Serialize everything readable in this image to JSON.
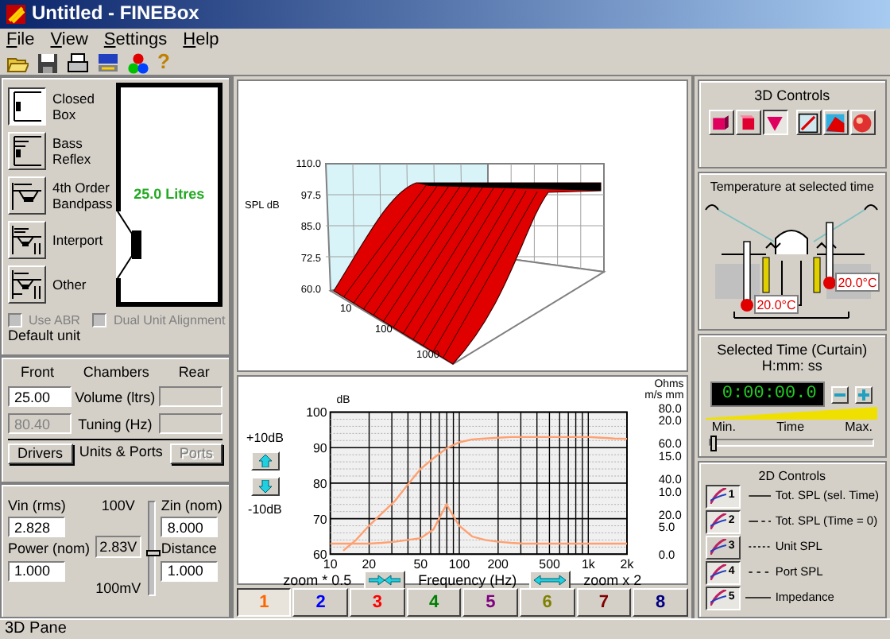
{
  "window": {
    "title": "Untitled - FINEBox"
  },
  "menu": [
    {
      "label": "File"
    },
    {
      "label": "View"
    },
    {
      "label": "Settings"
    },
    {
      "label": "Help"
    }
  ],
  "toolbar": [
    {
      "kind": "open"
    },
    {
      "kind": "save"
    },
    {
      "kind": "print"
    },
    {
      "kind": "panel"
    },
    {
      "kind": "colors"
    },
    {
      "kind": "help",
      "glyph": "?"
    }
  ],
  "enclosures": [
    {
      "kind": "closed",
      "label": "Closed Box",
      "selected": true
    },
    {
      "kind": "bass",
      "label": "Bass Reflex",
      "selected": false
    },
    {
      "kind": "bandpass",
      "label": "4th Order Bandpass",
      "selected": false
    },
    {
      "kind": "interport",
      "label": "Interport",
      "selected": false
    },
    {
      "kind": "other",
      "label": "Other",
      "selected": false
    }
  ],
  "box_display": {
    "volume": "25.0 Litres"
  },
  "options": [
    {
      "label": "Use ABR",
      "checked": false,
      "disabled": true
    },
    {
      "label": "Dual Unit Alignment",
      "checked": false,
      "disabled": true
    }
  ],
  "default_unit": "Default unit",
  "chambers": {
    "title": "Chambers",
    "front_heading": "Front",
    "rear_heading": "Rear",
    "rows": [
      {
        "label": "Volume (ltrs)",
        "front": "25.00",
        "front_disabled": false,
        "rear_disabled": true
      },
      {
        "label": "Tuning (Hz)",
        "front": "80.40",
        "front_disabled": true,
        "rear_disabled": true
      }
    ]
  },
  "units_ports": {
    "title": "Units & Ports",
    "buttons": [
      {
        "label": "Drivers",
        "disabled": false
      },
      {
        "label": "Ports",
        "disabled": true
      }
    ]
  },
  "signal": {
    "vin_label": "Vin (rms)",
    "vin": "2.828",
    "power_label": "Power (nom)",
    "power": "1.000",
    "scale_max": "100V",
    "scale_value": "2.83V",
    "scale_min": "100mV",
    "level": 0.45,
    "zin_label": "Zin (nom)",
    "zin": "8.000",
    "distance_label": "Distance",
    "distance": "1.000"
  },
  "plot3d": {
    "ylabel": "SPL dB",
    "yticks": [
      "110.0",
      "97.5",
      "85.0",
      "72.5",
      "60.0"
    ],
    "xticks": [
      "10",
      "100",
      "1000"
    ]
  },
  "plot2d": {
    "gain_buttons": [
      {
        "kind": "up",
        "label": "+10dB"
      },
      {
        "kind": "down",
        "label": "-10dB"
      }
    ],
    "right_unit_1": "Ohms",
    "right_unit_2": "m/s mm",
    "right_ticks": [
      {
        "a": "80.0",
        "b": "20.0"
      },
      {
        "a": "60.0",
        "b": "15.0"
      },
      {
        "a": "40.0",
        "b": "10.0"
      },
      {
        "a": "20.0",
        "b": "5.0"
      },
      {
        "a": "0.0"
      }
    ],
    "zoom_out": "zoom * 0.5",
    "zoom_in": "zoom x 2",
    "chart_data": {
      "type": "line",
      "xlabel": "Frequency (Hz)",
      "ylabel": "dB",
      "categories": [
        "10",
        null,
        null,
        "20",
        null,
        null,
        null,
        "50",
        null,
        null,
        "100",
        null,
        null,
        "200",
        null,
        null,
        null,
        "500",
        null,
        null,
        "1k",
        null,
        null,
        "2k"
      ],
      "series": [
        {
          "color": "#ffa070",
          "values": [
            null,
            61,
            64,
            68,
            71.5,
            75,
            79.5,
            84,
            87,
            89.8,
            91.5,
            92.3,
            92.6,
            92.8,
            93,
            93,
            93,
            93,
            93,
            93,
            93,
            92.8,
            92.6,
            92.5
          ]
        },
        {
          "color": "#ffa070",
          "values": [
            63,
            63,
            63,
            63,
            63.2,
            63.5,
            64,
            64.5,
            67,
            74,
            68,
            65,
            64,
            63.5,
            63.2,
            63,
            63,
            63,
            63,
            63,
            63,
            63,
            63,
            63
          ]
        }
      ],
      "ylim": [
        60,
        100
      ],
      "grid": true,
      "yticks": [
        60,
        70,
        80,
        90,
        100
      ]
    }
  },
  "tabs": [
    {
      "label": "1",
      "color": "#ff6600",
      "selected": true
    },
    {
      "label": "2",
      "color": "#0000ff",
      "selected": false
    },
    {
      "label": "3",
      "color": "#ff0000",
      "selected": false
    },
    {
      "label": "4",
      "color": "#008000",
      "selected": false
    },
    {
      "label": "5",
      "color": "#800080",
      "selected": false
    },
    {
      "label": "6",
      "color": "#808000",
      "selected": false
    },
    {
      "label": "7",
      "color": "#800000",
      "selected": false
    },
    {
      "label": "8",
      "color": "#000080",
      "selected": false
    }
  ],
  "controls3d": {
    "title": "3D Controls",
    "buttons": [
      {
        "kind": "cube-a",
        "pressed": false
      },
      {
        "kind": "cube-b",
        "pressed": false
      },
      {
        "kind": "wedge",
        "pressed": true
      },
      {
        "kind": "frame",
        "pressed": false
      },
      {
        "kind": "surface",
        "pressed": false
      },
      {
        "kind": "sphere",
        "pressed": false
      }
    ]
  },
  "temperature": {
    "title": "Temperature at selected time",
    "readings": [
      "20.0°C",
      "20.0°C"
    ]
  },
  "time": {
    "title": "Selected Time (Curtain)",
    "format": "H:mm: ss",
    "display": "0:00:00.0",
    "min_label": "Min.",
    "mid_label": "Time",
    "max_label": "Max.",
    "level": 0
  },
  "controls2d": {
    "title": "2D Controls",
    "rows": [
      {
        "number": "1",
        "kind": "solid",
        "label": "Tot. SPL (sel. Time)",
        "pressed": true
      },
      {
        "number": "2",
        "kind": "longshort",
        "label": "Tot. SPL (Time = 0)",
        "pressed": true
      },
      {
        "number": "3",
        "kind": "dotted",
        "label": "Unit SPL",
        "pressed": false
      },
      {
        "number": "4",
        "kind": "dashed",
        "label": "Port SPL",
        "pressed": true
      },
      {
        "number": "5",
        "kind": "long",
        "label": "Impedance",
        "pressed": true
      }
    ]
  },
  "status_bar": "3D Pane"
}
